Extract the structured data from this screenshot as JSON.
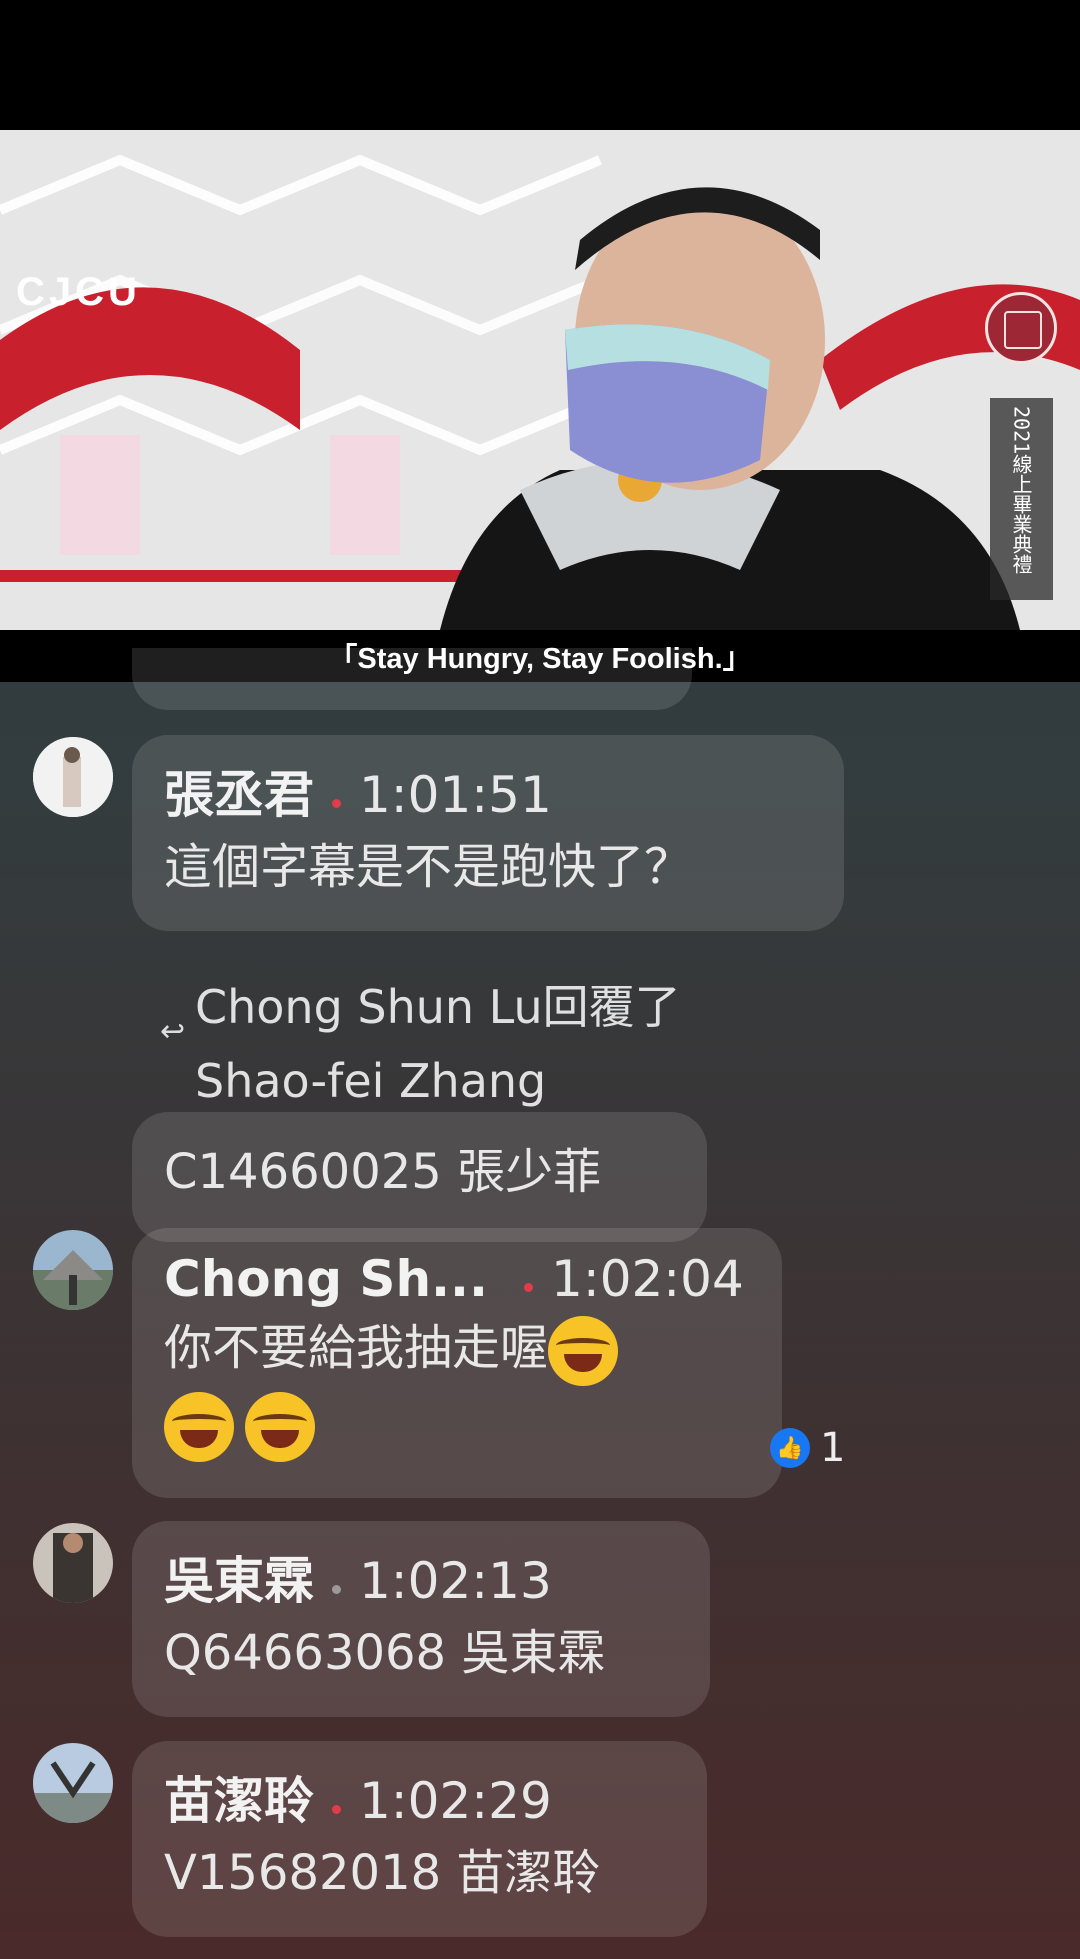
{
  "video": {
    "logo": "CJCU",
    "badge_year": "2021",
    "badge_title": "線上畢業典禮",
    "caption": "「Stay Hungry, Stay Foolish.」"
  },
  "comments": [
    {
      "name": "張丞君",
      "time": "1:01:51",
      "text": "這個字幕是不是跑快了？",
      "dot_color": "#e23b4b"
    },
    {
      "reply_author": "Chong Shun Lu回覆了",
      "reply_to": "Shao-fei Zhang",
      "text": "C14660025 張少菲"
    },
    {
      "name": "Chong Sh...",
      "time": "1:02:04",
      "text_line1": "你不要給我抽走喔",
      "likes": "1",
      "dot_color": "#e23b4b"
    },
    {
      "name": "吳東霖",
      "time": "1:02:13",
      "text": "Q64663068 吳東霖",
      "dot_color": "#9a9a9a"
    },
    {
      "name": "苗潔聆",
      "time": "1:02:29",
      "text": "V15682018 苗潔聆",
      "dot_color": "#e23b4b"
    }
  ],
  "colors": {
    "like_blue": "#1877f2",
    "brand_red": "#9e2735"
  },
  "icons": [
    "reply-arrow-icon",
    "thumbs-up-icon",
    "laughing-emoji-icon",
    "university-seal-icon"
  ]
}
